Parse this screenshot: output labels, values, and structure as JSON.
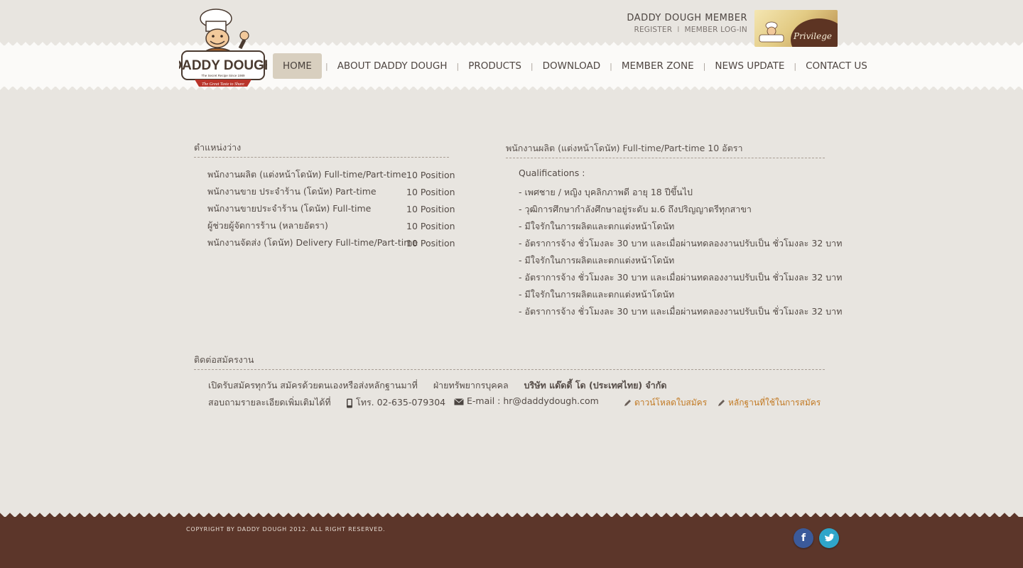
{
  "member": {
    "title": "DADDY DOUGH MEMBER",
    "register": "REGISTER",
    "separator": "I",
    "login": "MEMBER LOG-IN",
    "privilege_text": "Privilege"
  },
  "logo": {
    "name": "DADDY DOUGH",
    "tagline": "The Secret Recipe Since 1989",
    "ribbon": "The Great Taste to Share"
  },
  "nav": {
    "items": [
      "HOME",
      "ABOUT DADDY DOUGH",
      "PRODUCTS",
      "DOWNLOAD",
      "MEMBER ZONE",
      "NEWS UPDATE",
      "CONTACT US"
    ],
    "separator": "|"
  },
  "positions": {
    "heading": "ตำแหน่งว่าง",
    "rows": [
      {
        "title": "พนักงานผลิต (แต่งหน้าโดนัท) Full-time/Part-time",
        "count": "10 Position"
      },
      {
        "title": "พนักงานขาย ประจำร้าน (โดนัท) Part-time",
        "count": "10 Position"
      },
      {
        "title": "พนักงานขายประจำร้าน (โดนัท) Full-time",
        "count": "10 Position"
      },
      {
        "title": "ผู้ช่วยผู้จัดการร้าน (หลายอัตรา)",
        "count": "10 Position"
      },
      {
        "title": "พนักงานจัดส่ง (โดนัท) Delivery Full-time/Part-time",
        "count": "10 Position"
      }
    ]
  },
  "detail": {
    "heading": "พนักงานผลิต (แต่งหน้าโดนัท) Full-time/Part-time 10 อัตรา",
    "qual_heading": "Qualifications :",
    "items": [
      "- เพศชาย / หญิง บุคลิกภาพดี อายุ 18 ปีขึ้นไป",
      "- วุฒิการศึกษากำลังศึกษาอยู่ระดับ ม.6 ถึงปริญญาตรีทุกสาขา",
      "- มีใจรักในการผลิตและตกแต่งหน้าโดนัท",
      "- อัตราการจ้าง ชั่วโมงละ 30 บาท และเมื่อผ่านทดลองงานปรับเป็น ชั่วโมงละ 32 บาท",
      "- มีใจรักในการผลิตและตกแต่งหน้าโดนัท",
      "- อัตราการจ้าง ชั่วโมงละ 30 บาท และเมื่อผ่านทดลองงานปรับเป็น ชั่วโมงละ 32 บาท",
      "- มีใจรักในการผลิตและตกแต่งหน้าโดนัท",
      "- อัตราการจ้าง ชั่วโมงละ 30 บาท และเมื่อผ่านทดลองงานปรับเป็น ชั่วโมงละ 32 บาท"
    ]
  },
  "contact": {
    "heading": "ติดต่อสมัครงาน",
    "line1_a": "เปิดรับสมัครทุกวัน สมัครด้วยตนเองหรือส่งหลักฐานมาที่",
    "line1_b": "ฝ่ายทรัพยากรบุคคล",
    "line1_c": "บริษัท แด๊ดดี้ โด (ประเทศไทย) จำกัด",
    "line2_a": "สอบถามรายละเอียดเพิ่มเติมได้ที่",
    "phone": "โทร. 02-635-079304",
    "email": "E-mail : hr@daddydough.com",
    "download_link": "ดาวน์โหลดใบสมัคร",
    "docs_link": "หลักฐานที่ใช้ในการสมัคร"
  },
  "footer": {
    "copyright": "COPYRIGHT BY DADDY DOUGH 2012. ALL RIGHT RESERVED.",
    "facebook_glyph": "f"
  },
  "colors": {
    "background": "#e8e5e0",
    "footer": "#5c362a",
    "link_orange": "#c27a24",
    "facebook": "#3b5a9a",
    "twitter": "#2fa5c9"
  }
}
